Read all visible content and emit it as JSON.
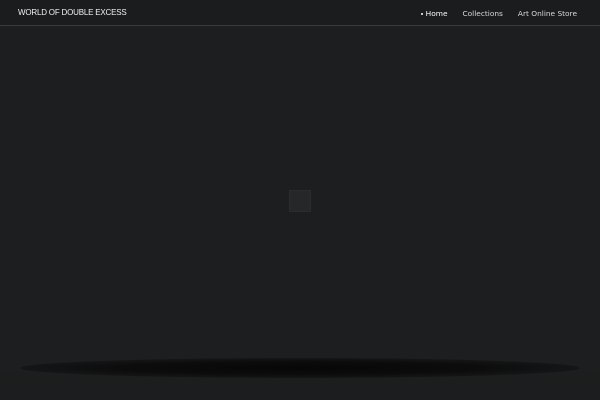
{
  "header": {
    "logo": "WORLD OF DOUBLE EXCESS",
    "nav": [
      {
        "label": "Home",
        "active": true
      },
      {
        "label": "Collections",
        "active": false
      },
      {
        "label": "Art Online Store",
        "active": false
      }
    ]
  },
  "colors": {
    "background": "#1d1e1f",
    "header_background": "#1b1c1d",
    "header_border": "#3a3b3c",
    "text": "#e6e6e6",
    "loader": "#262728"
  }
}
